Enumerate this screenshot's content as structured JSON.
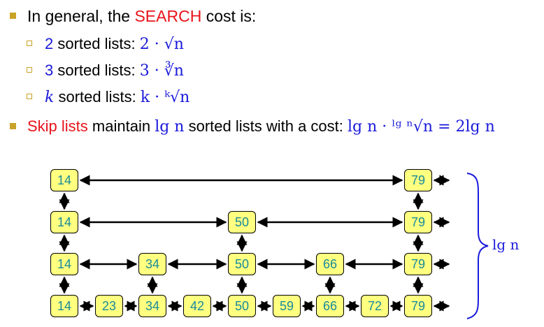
{
  "bullets": {
    "general": {
      "pre": "In general, the ",
      "highlight": "SEARCH",
      "post": " cost is:"
    },
    "two": {
      "k": "2",
      "label": " sorted lists: ",
      "math": "2 · √n"
    },
    "three": {
      "k": "3",
      "label": " sorted lists: ",
      "math": "3 · ∛n"
    },
    "kk": {
      "k": "k",
      "label": " sorted lists: ",
      "math": "k · ᵏ√n"
    },
    "skip": {
      "highlight": "Skip lists",
      "pre": " maintain ",
      "lg": "lg n",
      "post": " sorted lists with a cost: ",
      "math": "lg n · ˡᵍ ⁿ√n = 2lg n"
    }
  },
  "levels": [
    {
      "level": 4,
      "keys": [
        "14",
        "79"
      ]
    },
    {
      "level": 3,
      "keys": [
        "14",
        "50",
        "79"
      ]
    },
    {
      "level": 2,
      "keys": [
        "14",
        "34",
        "50",
        "66",
        "79"
      ]
    },
    {
      "level": 1,
      "keys": [
        "14",
        "23",
        "34",
        "42",
        "50",
        "59",
        "66",
        "72",
        "79"
      ]
    }
  ],
  "brace_label": "lg n",
  "colors": {
    "node_fill": "#ffff80",
    "node_text": "#1a8a9a",
    "highlight": "#e8141b",
    "math": "#1a1adb",
    "bullet": "#c9a228"
  }
}
